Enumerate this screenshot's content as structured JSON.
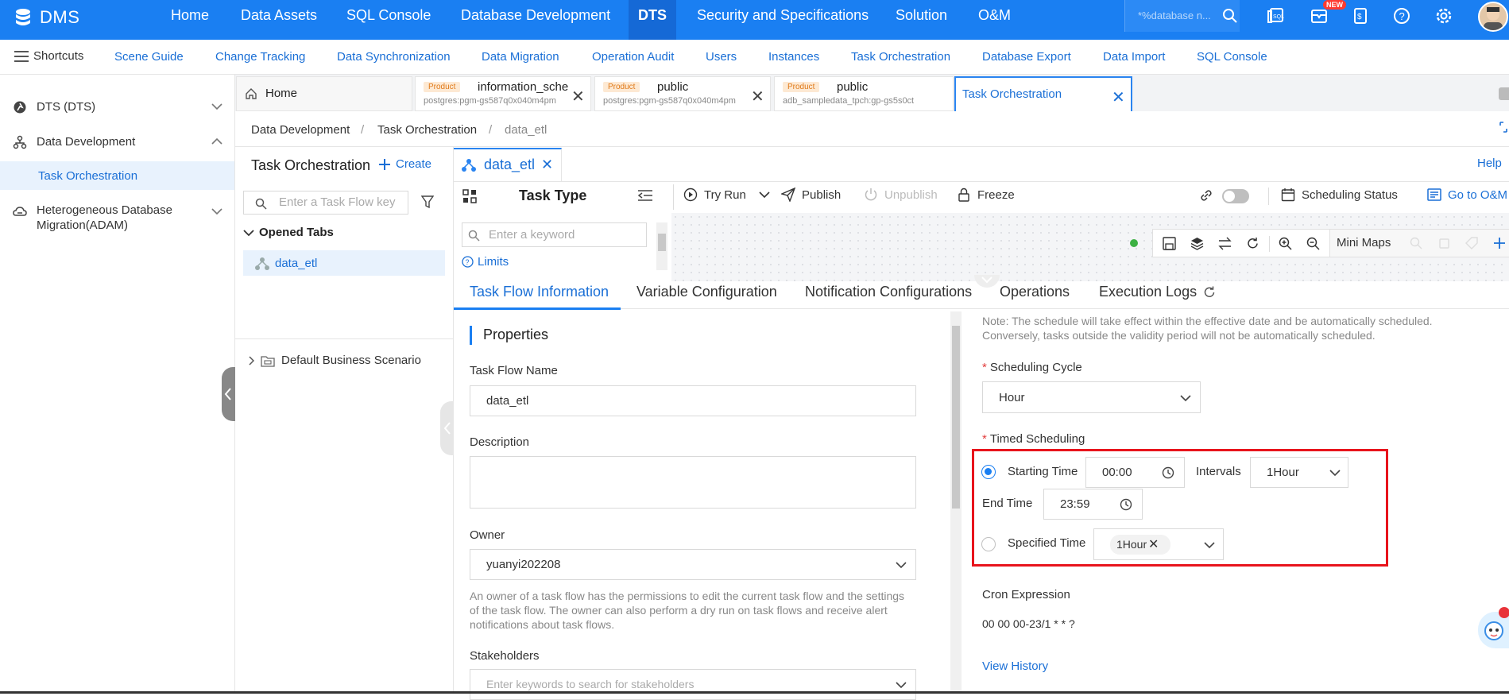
{
  "nav": {
    "brand": "DMS",
    "items": [
      "Home",
      "Data Assets",
      "SQL Console",
      "Database Development",
      "DTS",
      "Security and Specifications",
      "Solution",
      "O&M"
    ],
    "search_placeholder": "*%database n...",
    "new_badge": "NEW"
  },
  "shortcuts": {
    "label": "Shortcuts",
    "items": [
      "Scene Guide",
      "Change Tracking",
      "Data Synchronization",
      "Data Migration",
      "Operation Audit",
      "Users",
      "Instances",
      "Task Orchestration",
      "Database Export",
      "Data Import",
      "SQL Console"
    ]
  },
  "sidebar": {
    "items": [
      "DTS (DTS)",
      "Data Development",
      "Task Orchestration",
      "Heterogeneous Database",
      "Migration(ADAM)"
    ]
  },
  "tabs": {
    "home": "Home",
    "product_tag": "Product",
    "tab1": {
      "title": "information_sche",
      "sub": "postgres:pgm-gs587q0x040m4pm"
    },
    "tab2": {
      "title": "public",
      "sub": "postgres:pgm-gs587q0x040m4pm"
    },
    "tab3": {
      "title": "public",
      "sub": "adb_sampledata_tpch:gp-gs5s0ct"
    },
    "tab4": {
      "title": "Task Orchestration"
    }
  },
  "breadcrumb": [
    "Data Development",
    "Task Orchestration",
    "data_etl"
  ],
  "help": "Help",
  "orch": {
    "title": "Task Orchestration",
    "create": "Create",
    "search_placeholder": "Enter a Task Flow key",
    "opened_tabs": "Opened Tabs",
    "opened_item": "data_etl",
    "scenario": "Default Business Scenario"
  },
  "flow_tab": "data_etl",
  "toolbar": {
    "task_type": "Task Type",
    "keyword_placeholder": "Enter a keyword",
    "limits": "Limits",
    "try_run": "Try Run",
    "publish": "Publish",
    "unpublish": "Unpublish",
    "freeze": "Freeze",
    "scheduling_status": "Scheduling Status",
    "go_to_om": "Go to O&M",
    "mini_maps": "Mini Maps"
  },
  "content_tabs": [
    "Task Flow Information",
    "Variable Configuration",
    "Notification Configurations",
    "Operations",
    "Execution Logs"
  ],
  "properties": {
    "heading": "Properties",
    "name_label": "Task Flow Name",
    "name_value": "data_etl",
    "desc_label": "Description",
    "owner_label": "Owner",
    "owner_value": "yuanyi202208",
    "owner_note": "An owner of a task flow has the permissions to edit the current task flow and the settings of the task flow. The owner can also perform a dry run on task flows and receive alert notifications about task flows.",
    "stakeholders_label": "Stakeholders",
    "stakeholders_placeholder": "Enter keywords to search for stakeholders"
  },
  "scheduling": {
    "note": "Note: The schedule will take effect within the effective date and be automatically scheduled. Conversely, tasks outside the validity period will not be automatically scheduled.",
    "cycle_label": "Scheduling Cycle",
    "cycle_value": "Hour",
    "timed_label": "Timed Scheduling",
    "starting_time_label": "Starting Time",
    "starting_time_value": "00:00",
    "intervals_label": "Intervals",
    "intervals_value": "1Hour",
    "end_time_label": "End Time",
    "end_time_value": "23:59",
    "specified_time_label": "Specified Time",
    "specified_time_tag": "1Hour",
    "cron_label": "Cron Expression",
    "cron_value": "00 00 00-23/1 * * ?",
    "view_history": "View History"
  }
}
